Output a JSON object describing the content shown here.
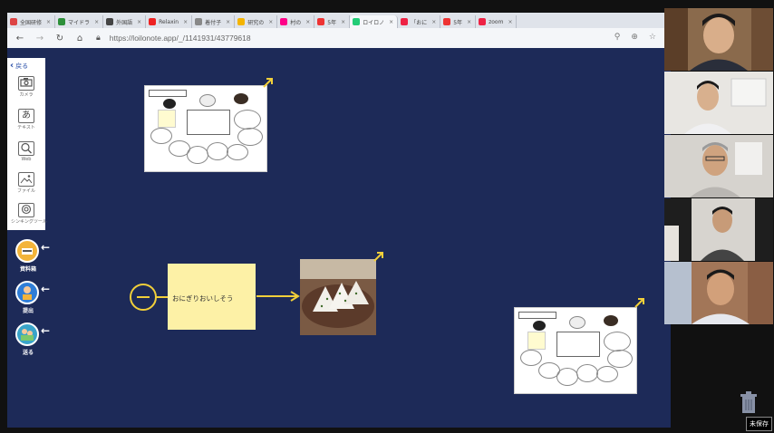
{
  "tabs": [
    {
      "title": "全国研修",
      "color": "#d44"
    },
    {
      "title": "マイドラ",
      "color": "#2d8f3a"
    },
    {
      "title": "外国語",
      "color": "#444"
    },
    {
      "title": "Relaxin",
      "color": "#e22"
    },
    {
      "title": "着付子",
      "color": "#888"
    },
    {
      "title": "研究の",
      "color": "#f4b400"
    },
    {
      "title": "村の",
      "color": "#f08"
    },
    {
      "title": "5年",
      "color": "#e33"
    },
    {
      "title": "ロイロノ",
      "color": "#2c7"
    },
    {
      "title": "「おに",
      "color": "#e24"
    },
    {
      "title": "5年",
      "color": "#e33"
    },
    {
      "title": "zoom",
      "color": "#e24"
    }
  ],
  "tab_close": "×",
  "active_tab_index": 8,
  "address": {
    "url": "https://loilonote.app/_/1141931/43779618"
  },
  "sidebar": {
    "back_label": "戻る",
    "tools": [
      {
        "label": "カメラ",
        "icon": "camera-icon"
      },
      {
        "label": "テキスト",
        "glyph": "あ",
        "icon": "text-icon"
      },
      {
        "label": "Web",
        "icon": "web-search-icon"
      },
      {
        "label": "ファイル",
        "icon": "file-image-icon"
      },
      {
        "label": "シンキングツール",
        "icon": "thinking-tool-icon"
      }
    ]
  },
  "actions": [
    {
      "label": "資料箱",
      "icon": "document-box-icon"
    },
    {
      "label": "提出",
      "icon": "submit-person-icon"
    },
    {
      "label": "送る",
      "icon": "send-people-icon"
    }
  ],
  "canvas": {
    "note_text": "おにぎりおいしそう"
  },
  "unsaved_label": "未保存",
  "colors": {
    "canvas_bg": "#1d2a58",
    "accent_yellow": "#f1cf3a",
    "note_yellow": "#fdf1a6",
    "action_blue": "#2f7dd7"
  }
}
